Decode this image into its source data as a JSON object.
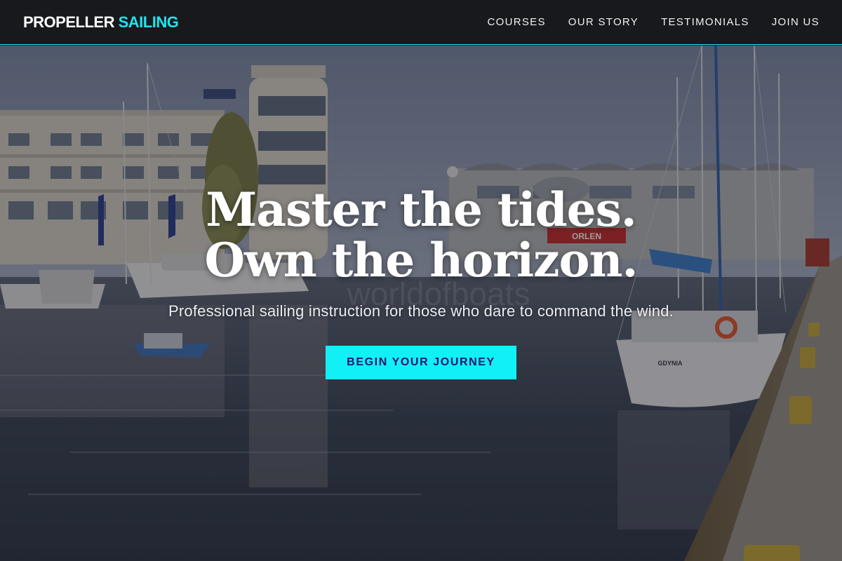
{
  "brand": {
    "name_primary": "PROPELLER",
    "name_accent": "SAILING",
    "accent_color": "#22e3ee"
  },
  "nav": {
    "items": [
      {
        "label": "COURSES"
      },
      {
        "label": "OUR STORY"
      },
      {
        "label": "TESTIMONIALS"
      },
      {
        "label": "JOIN US"
      }
    ]
  },
  "hero": {
    "headline_line1": "Master the tides.",
    "headline_line2": "Own the horizon.",
    "subtitle": "Professional sailing instruction for those who dare to command the wind.",
    "cta_label": "BEGIN YOUR JOURNEY",
    "cta_color": "#11f0f5",
    "background_image": "marina-harbor-photo",
    "watermark_text": "worldofboats",
    "boat_name": "GDYNIA",
    "sign_text": "ORLEN"
  }
}
